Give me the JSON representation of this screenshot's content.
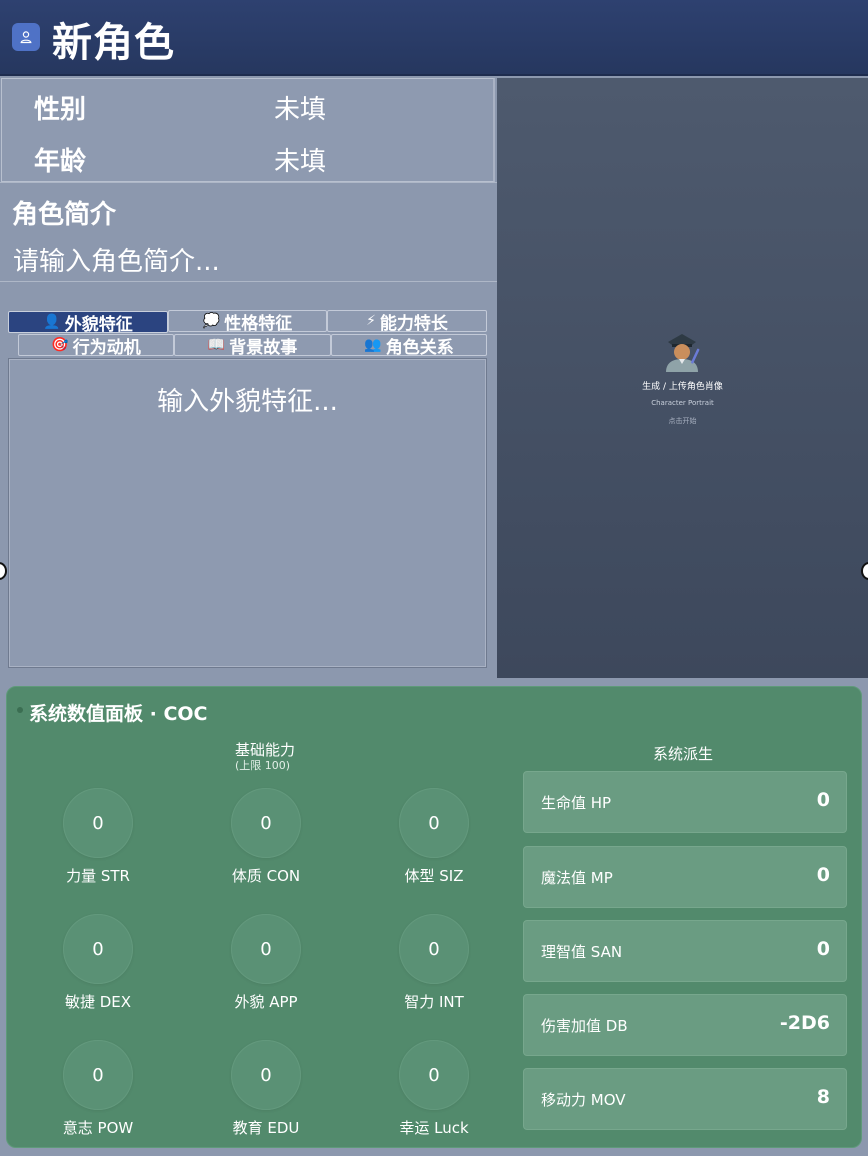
{
  "header": {
    "title": "新角色",
    "icon": "user-icon"
  },
  "attributes": [
    {
      "label": "性别",
      "value": "未填"
    },
    {
      "label": "年龄",
      "value": "未填"
    }
  ],
  "intro": {
    "label": "角色简介",
    "placeholder": "请输入角色简介..."
  },
  "tabs_row1": [
    {
      "icon": "👤",
      "label": "外貌特征",
      "active": true
    },
    {
      "icon": "💭",
      "label": "性格特征"
    },
    {
      "icon": "⚡",
      "label": "能力特长"
    }
  ],
  "tabs_row2": [
    {
      "icon": "🎯",
      "label": "行为动机"
    },
    {
      "icon": "📖",
      "label": "背景故事"
    },
    {
      "icon": "👥",
      "label": "角色关系"
    }
  ],
  "editor": {
    "placeholder": "输入外貌特征..."
  },
  "portrait": {
    "line1": "生成 / 上传角色肖像",
    "line2": "Character Portrait",
    "line3": "点击开始",
    "icon": "police-officer-icon"
  },
  "stats": {
    "title": "系统数值面板 · COC",
    "base_title": "基础能力",
    "base_sub": "(上限 100)",
    "derived_title": "系统派生",
    "base": [
      {
        "label": "力量 STR",
        "value": "0"
      },
      {
        "label": "体质 CON",
        "value": "0"
      },
      {
        "label": "体型 SIZ",
        "value": "0"
      },
      {
        "label": "敏捷 DEX",
        "value": "0"
      },
      {
        "label": "外貌 APP",
        "value": "0"
      },
      {
        "label": "智力 INT",
        "value": "0"
      },
      {
        "label": "意志 POW",
        "value": "0"
      },
      {
        "label": "教育 EDU",
        "value": "0"
      },
      {
        "label": "幸运 Luck",
        "value": "0"
      }
    ],
    "derived": [
      {
        "label": "生命值 HP",
        "value": "0"
      },
      {
        "label": "魔法值 MP",
        "value": "0"
      },
      {
        "label": "理智值 SAN",
        "value": "0"
      },
      {
        "label": "伤害加值 DB",
        "value": "-2D6"
      },
      {
        "label": "移动力 MOV",
        "value": "8"
      }
    ]
  }
}
